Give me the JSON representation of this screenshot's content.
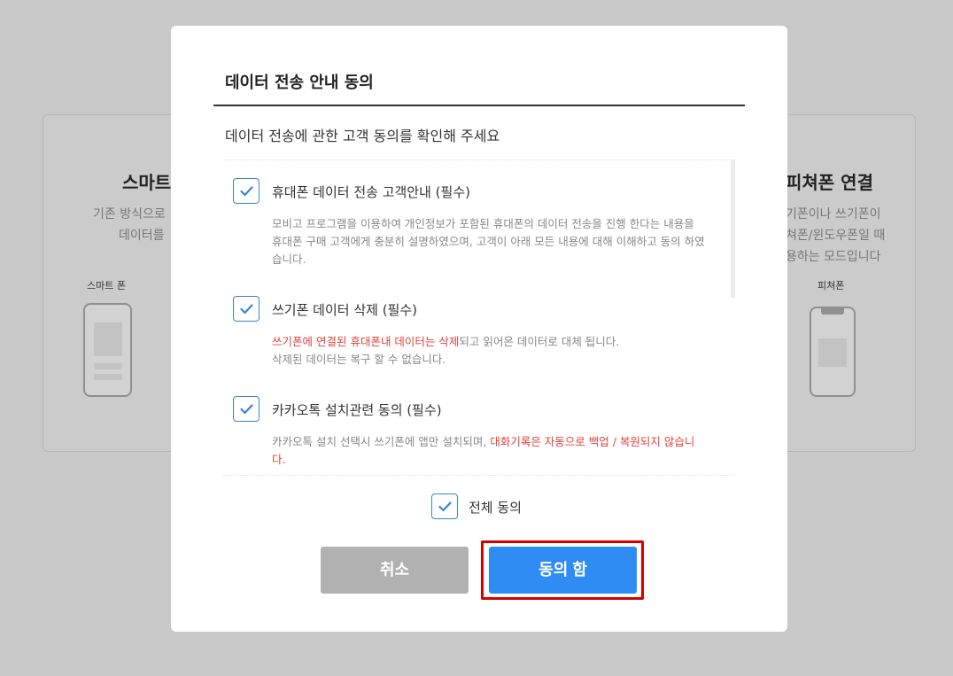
{
  "background": {
    "left_card": {
      "title": "스마트",
      "desc_line1": "기존 방식으로",
      "desc_line2": "데이터를",
      "phone_label": "스마트 폰"
    },
    "right_card": {
      "title": "피쳐폰 연결",
      "desc_line1": "기폰이나 쓰기폰이",
      "desc_line2": "쳐폰/윈도우폰일 때",
      "desc_line3": "용하는 모드입니다",
      "phone_label": "피쳐폰"
    }
  },
  "modal": {
    "title": "데이터 전송 안내 동의",
    "subtitle": "데이터 전송에 관한 고객 동의를 확인해 주세요",
    "items": [
      {
        "title": "휴대폰 데이터 전송 고객안내 (필수)",
        "desc": "모비고 프로그램을 이용하여 개인정보가 포함된 휴대폰의 데이터 전송을 진행 한다는 내용을 휴대폰 구매 고객에게 충분히 설명하였으며, 고객이 아래 모든 내용에 대해 이해하고 동의 하였습니다.",
        "checked": true
      },
      {
        "title": "쓰기폰 데이터 삭제 (필수)",
        "desc_red": "쓰기폰에 연결된 휴대폰내 데이터는 삭제",
        "desc_rest": "되고 읽어온 데이터로 대체 됩니다.",
        "desc_line2": "삭제된 데이터는 복구 할 수 없습니다.",
        "checked": true
      },
      {
        "title": "카카오톡 설치관련 동의 (필수)",
        "desc_plain": "카카오톡 설치 선택시 쓰기폰에 앱만 설치되며, ",
        "desc_red": "대화기록은 자동으로 백업 / 복원되지 않습니다.",
        "checked": true
      }
    ],
    "all_agree_label": "전체 동의",
    "cancel_label": "취소",
    "confirm_label": "동의 함"
  },
  "colors": {
    "accent": "#2f8cf4",
    "warning": "#e0433a",
    "highlight": "#d40000"
  }
}
